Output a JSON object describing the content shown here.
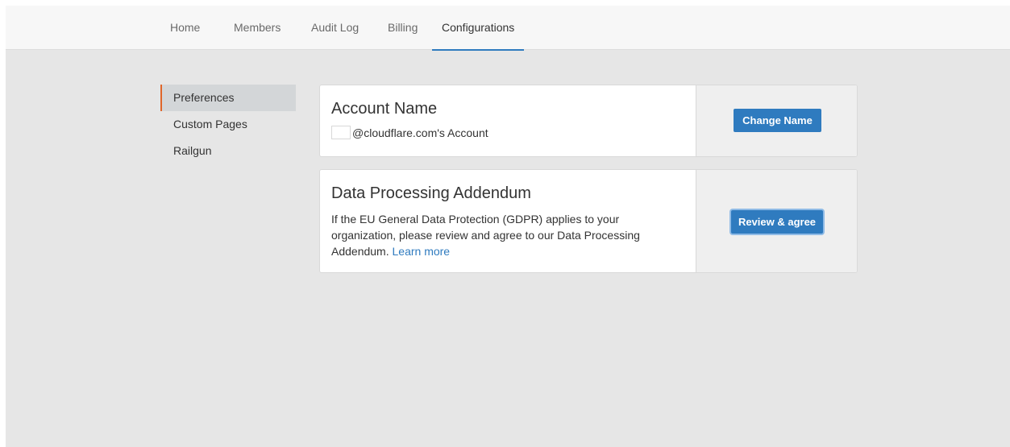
{
  "nav": {
    "tabs": [
      {
        "label": "Home"
      },
      {
        "label": "Members"
      },
      {
        "label": "Audit Log"
      },
      {
        "label": "Billing"
      },
      {
        "label": "Configurations",
        "active": true
      }
    ]
  },
  "sidebar": {
    "items": [
      {
        "label": "Preferences",
        "active": true
      },
      {
        "label": "Custom Pages"
      },
      {
        "label": "Railgun"
      }
    ]
  },
  "account_card": {
    "title": "Account Name",
    "account_suffix": "@cloudflare.com's Account",
    "button_label": "Change Name"
  },
  "dpa_card": {
    "title": "Data Processing Addendum",
    "description": "If the EU General Data Protection (GDPR) applies to your organization, please review and agree to our Data Processing Addendum.",
    "link_label": "Learn more",
    "button_label": "Review & agree"
  },
  "colors": {
    "accent_blue": "#2f7bbf",
    "sidebar_active_border": "#e0662a",
    "page_background": "#e6e6e6"
  }
}
